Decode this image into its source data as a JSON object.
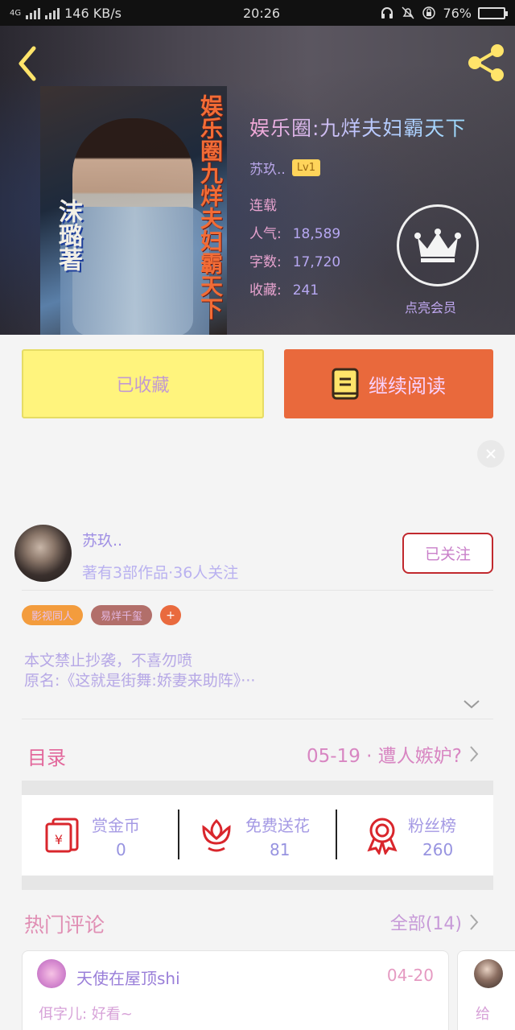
{
  "status_bar": {
    "network": "4G",
    "speed": "146 KB/s",
    "time": "20:26",
    "battery": "76%"
  },
  "book": {
    "cover_title": "娱乐圈九烊夫妇霸天下",
    "cover_author": "沫璐著",
    "title": "娱乐圈:九烊夫妇霸天下",
    "author": "苏玖..",
    "level": "Lv1",
    "status": "连载",
    "popularity_label": "人气:",
    "popularity": "18,589",
    "words_label": "字数:",
    "words": "17,720",
    "favorites_label": "收藏:",
    "favorites": "241",
    "light_label": "点亮会员"
  },
  "actions": {
    "collected_label": "已收藏",
    "read_label": "继续阅读",
    "colors": {
      "collected_bg": "#fff47d",
      "read_bg": "#e9693c"
    }
  },
  "author_card": {
    "name": "苏玖..",
    "stats": "著有3部作品·36人关注",
    "follow_label": "已关注"
  },
  "tags": [
    "影视同人",
    "易烊千玺",
    "+"
  ],
  "description": {
    "line1": "本文禁止抄袭，不喜勿喷",
    "line2": "原名:《这就是街舞:娇妻来助阵》···"
  },
  "catalog": {
    "label": "目录",
    "latest": "05-19 · 遭人嫉妒?"
  },
  "stats": [
    {
      "label": "赏金币",
      "value": "0",
      "icon": "red-envelope-icon"
    },
    {
      "label": "免费送花",
      "value": "81",
      "icon": "flower-icon"
    },
    {
      "label": "粉丝榜",
      "value": "260",
      "icon": "medal-icon"
    }
  ],
  "comments": {
    "title": "热门评论",
    "all_label": "全部(14)",
    "items": [
      {
        "user": "天使在屋顶shi",
        "date": "04-20",
        "text": "佴字儿: 好看~"
      },
      {
        "text": "给"
      }
    ]
  }
}
